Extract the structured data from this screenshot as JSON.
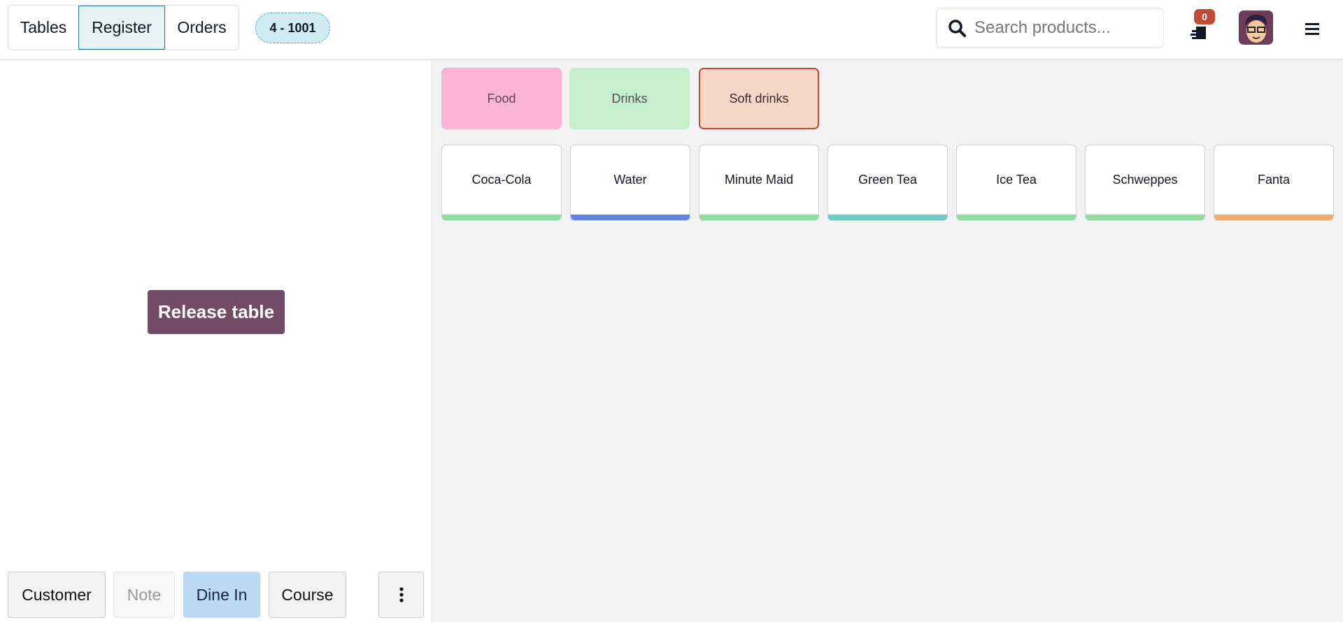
{
  "header": {
    "tabs": [
      {
        "label": "Tables"
      },
      {
        "label": "Register"
      },
      {
        "label": "Orders"
      }
    ],
    "order_badge": "4 - 1001",
    "search_placeholder": "Search products...",
    "orders_count": "0"
  },
  "left": {
    "release_label": "Release table",
    "buttons": {
      "customer": "Customer",
      "note": "Note",
      "dine_in": "Dine In",
      "course": "Course"
    }
  },
  "categories": [
    {
      "label": "Food",
      "color": "#fbb3d6"
    },
    {
      "label": "Drinks",
      "color": "#c5efcd"
    },
    {
      "label": "Soft drinks",
      "color": "#f7d6c8"
    }
  ],
  "products": [
    {
      "name": "Coca-Cola",
      "color": "#95dc9f"
    },
    {
      "name": "Water",
      "color": "#5f87e1"
    },
    {
      "name": "Minute Maid",
      "color": "#95dc9f"
    },
    {
      "name": "Green Tea",
      "color": "#6ccbc8"
    },
    {
      "name": "Ice Tea",
      "color": "#95dc9f"
    },
    {
      "name": "Schweppes",
      "color": "#95dc9f"
    },
    {
      "name": "Fanta",
      "color": "#f0ad6e"
    }
  ]
}
